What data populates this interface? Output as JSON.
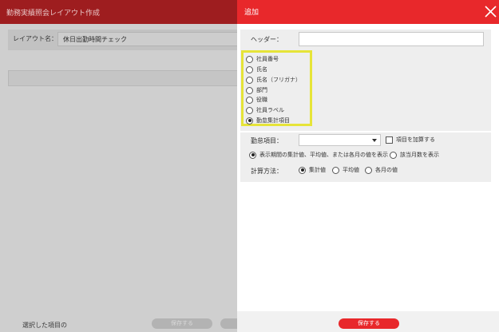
{
  "background": {
    "title": "勤務実績照会レイアウト作成",
    "layout_name_label": "レイアウト名：",
    "layout_name_value": "休日出勤時間チェック",
    "footer_label": "選択した項目の",
    "save_label": "保存する"
  },
  "dialog": {
    "title": "追加",
    "header_label": "ヘッダー：",
    "header_value": "",
    "item_types": [
      {
        "label": "社員番号",
        "selected": false
      },
      {
        "label": "氏名",
        "selected": false
      },
      {
        "label": "氏名（フリガナ）",
        "selected": false
      },
      {
        "label": "部門",
        "selected": false
      },
      {
        "label": "役職",
        "selected": false
      },
      {
        "label": "社員ラベル",
        "selected": false
      },
      {
        "label": "勤怠集計項目",
        "selected": true
      }
    ],
    "attendance_item_label": "勤怠項目：",
    "attendance_item_value": "",
    "add_items_label": "項目を加算する",
    "display_modes": [
      {
        "label": "表示期間の集計値、平均値、または各月の値を表示",
        "selected": true
      },
      {
        "label": "該当月数を表示",
        "selected": false
      }
    ],
    "calc_label": "計算方法：",
    "calc_methods": [
      {
        "label": "集計値",
        "selected": true
      },
      {
        "label": "平均値",
        "selected": false
      },
      {
        "label": "各月の値",
        "selected": false
      }
    ],
    "save_label": "保存する"
  },
  "colors": {
    "header_red": "#e8282b",
    "highlight_yellow": "#e6e438"
  }
}
